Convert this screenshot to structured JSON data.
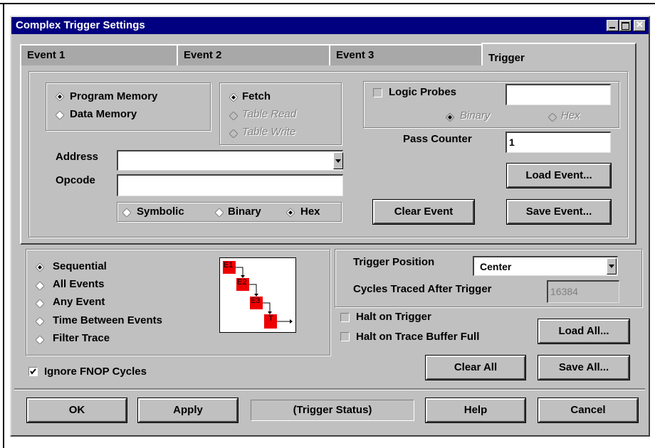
{
  "window": {
    "title": "Complex Trigger Settings"
  },
  "tabs": [
    {
      "label": "Event 1"
    },
    {
      "label": "Event 2"
    },
    {
      "label": "Event 3"
    },
    {
      "label": "Trigger"
    }
  ],
  "event": {
    "memory_options": [
      "Program Memory",
      "Data Memory"
    ],
    "memory_selected": "Program Memory",
    "access_options": [
      "Fetch",
      "Table Read",
      "Table Write"
    ],
    "access_selected": "Fetch",
    "address_label": "Address",
    "address_value": "",
    "opcode_label": "Opcode",
    "opcode_value": "",
    "format_options": [
      "Symbolic",
      "Binary",
      "Hex"
    ],
    "format_selected": "Hex",
    "logic_probes_label": "Logic Probes",
    "logic_probes_checked": false,
    "logic_probes_value": "",
    "probe_format_options": [
      "Binary",
      "Hex"
    ],
    "probe_format_selected": "Binary",
    "pass_counter_label": "Pass Counter",
    "pass_counter_value": "1",
    "load_event": "Load Event...",
    "clear_event": "Clear Event",
    "save_event": "Save Event..."
  },
  "sequence": {
    "options": [
      "Sequential",
      "All Events",
      "Any Event",
      "Time Between Events",
      "Filter Trace"
    ],
    "selected": "Sequential",
    "diagram_labels": [
      "E1",
      "E2",
      "E3",
      "T"
    ]
  },
  "trigger": {
    "position_label": "Trigger Position",
    "position_value": "Center",
    "cycles_label": "Cycles Traced After Trigger",
    "cycles_value": "16384",
    "halt_on_trigger": "Halt on Trigger",
    "halt_on_trigger_checked": false,
    "halt_on_buffer_full": "Halt on Trace Buffer Full",
    "halt_on_buffer_full_checked": false
  },
  "ignore_fnop": {
    "label": "Ignore FNOP Cycles",
    "checked": true
  },
  "buttons": {
    "load_all": "Load All...",
    "clear_all": "Clear All",
    "save_all": "Save All...",
    "ok": "OK",
    "apply": "Apply",
    "status": "(Trigger Status)",
    "help": "Help",
    "cancel": "Cancel"
  },
  "colors": {
    "titlebar": "#000080",
    "face": "#c0c0c0",
    "event_box": "#ee0000"
  }
}
